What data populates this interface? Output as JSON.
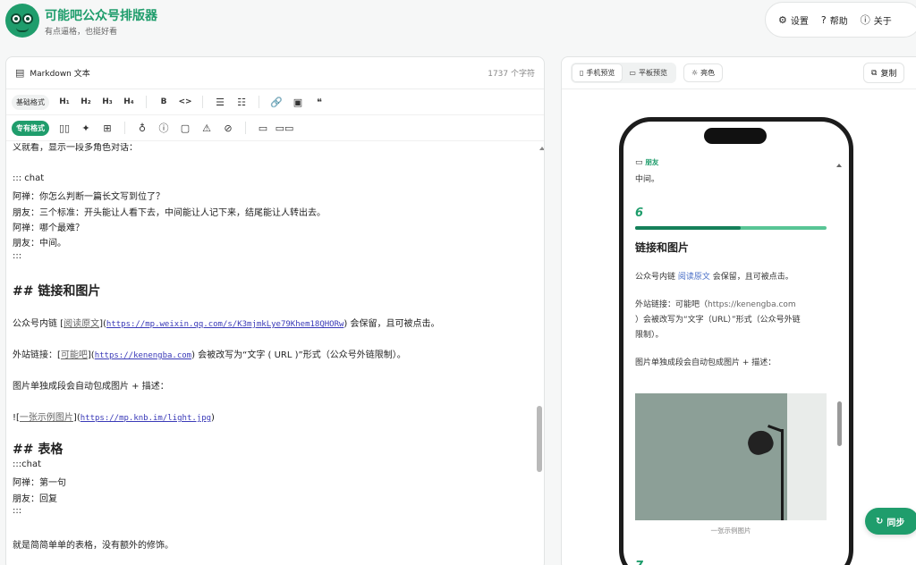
{
  "header": {
    "title": "可能吧公众号排版器",
    "subtitle": "有点逼格，也挺好看",
    "nav": [
      {
        "icon": "gear-icon",
        "glyph": "⚙",
        "label": "设置"
      },
      {
        "icon": "help-icon",
        "glyph": "?",
        "label": "帮助"
      },
      {
        "icon": "info-icon",
        "glyph": "ⓘ",
        "label": "关于"
      }
    ]
  },
  "editor": {
    "title": "Markdown 文本",
    "char_count": "1737 个字符",
    "toolbar1": {
      "tag": "基础格式",
      "h1": "H₁",
      "h2": "H₂",
      "h3": "H₃",
      "h4": "H₄",
      "bold": "B",
      "code": "<>",
      "ul": "☰",
      "ol": "☷",
      "link": "🔗",
      "image": "▣",
      "quote": "❝"
    },
    "toolbar2": {
      "tag": "专有格式",
      "book": "▯▯",
      "sparkle": "✦",
      "map": "⊞",
      "bulb": "♁",
      "info": "ⓘ",
      "file": "▢",
      "warn": "⚠",
      "ban": "⊘",
      "chat": "▭",
      "chats": "▭▭"
    },
    "lines": {
      "l0": "义就看，显示一段多角色对话：",
      "l1": "::: chat",
      "l2": "阿禅：你怎么判断一篇长文写到位了？",
      "l3": "朋友：三个标准：开头能让人看下去，中间能让人记下来，结尾能让人转出去。",
      "l4": "阿禅：哪个最难？",
      "l5": "朋友：中间。",
      "l6": ":::",
      "h2a": "## 链接和图片",
      "l7a": "公众号内链 [",
      "l7b": "阅读原文",
      "l7c": "](",
      "l7d": "https://mp.weixin.qq.com/s/K3mjmkLye79Khem18QHORw",
      "l7e": ") 会保留，且可被点击。",
      "l8a": "外站链接：[",
      "l8b": "可能吧",
      "l8c": "](",
      "l8d": "https://kenengba.com",
      "l8e": ") 会被改写为“文字 ( URL )”形式（公众号外链限制）。",
      "l9": "图片单独成段会自动包成图片 + 描述：",
      "l10a": "![",
      "l10b": "一张示例图片",
      "l10c": "](",
      "l10d": "https://mp.knb.im/light.jpg",
      "l10e": ")",
      "h2b": "## 表格",
      "l11": ":::chat",
      "l12": "阿禅：第一句",
      "l13": "朋友：回复",
      "l14": ":::",
      "l15": "就是简简单单的表格，没有额外的修饰。"
    }
  },
  "preview": {
    "tabs": [
      {
        "icon": "phone-icon",
        "glyph": "▯",
        "label": "手机预览"
      },
      {
        "icon": "tablet-icon",
        "glyph": "▭",
        "label": "平板预览"
      }
    ],
    "theme": {
      "glyph": "☼",
      "label": "亮色"
    },
    "copy": {
      "glyph": "⧉",
      "label": "复制"
    },
    "phone": {
      "speaker": "朋友",
      "speaker_glyph": "▭",
      "line1": "中间。",
      "section_num": "6",
      "section_progress": 0.55,
      "section_title": "链接和图片",
      "p1a": "公众号内链 ",
      "p1b": "阅读原文",
      "p1c": " 会保留，且可被点击。",
      "p2a": "外站链接：可能吧（",
      "p2b": "https://kenengba.com",
      "p2c": "）会被改写为“文字（URL）”形式（公众号外链",
      "p2d": "限制）。",
      "p3": "图片单独成段会自动包成图片 + 描述：",
      "caption": "一张示例图片",
      "next_num": "7"
    },
    "sync": {
      "glyph": "↻",
      "label": "同步"
    }
  }
}
